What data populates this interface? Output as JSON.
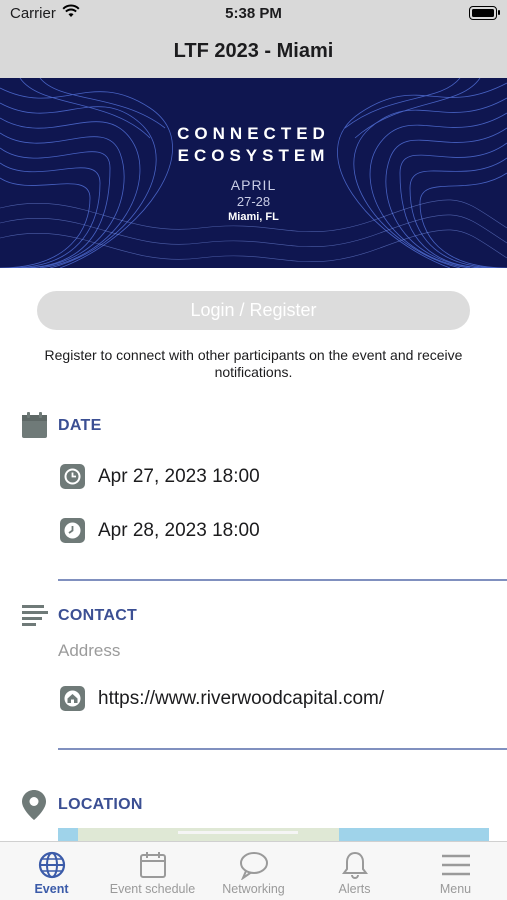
{
  "status_bar": {
    "carrier": "Carrier",
    "time": "5:38 PM"
  },
  "nav": {
    "title": "LTF 2023 - Miami"
  },
  "banner": {
    "line1": "CONNECTED",
    "line2": "ECOSYSTEM",
    "month": "APRIL",
    "days": "27-28",
    "place": "Miami, FL"
  },
  "login": {
    "button_label": "Login / Register",
    "note": "Register to connect with other participants on the event and receive notifications."
  },
  "date_section": {
    "title": "DATE",
    "items": [
      {
        "icon": "clock-icon",
        "text": "Apr 27, 2023 18:00"
      },
      {
        "icon": "clock-icon",
        "text": "Apr 28, 2023 18:00"
      }
    ]
  },
  "contact_section": {
    "title": "CONTACT",
    "address_label": "Address",
    "website": "https://www.riverwoodcapital.com/"
  },
  "location_section": {
    "title": "LOCATION"
  },
  "tabbar": {
    "items": [
      {
        "label": "Event",
        "icon": "globe-icon",
        "active": true
      },
      {
        "label": "Event schedule",
        "icon": "calendar-icon",
        "active": false
      },
      {
        "label": "Networking",
        "icon": "chat-bubble-icon",
        "active": false
      },
      {
        "label": "Alerts",
        "icon": "bell-icon",
        "active": false
      },
      {
        "label": "Menu",
        "icon": "hamburger-icon",
        "active": false
      }
    ]
  },
  "colors": {
    "accent": "#3b4f93",
    "tab_active": "#3b5ba9",
    "banner_bg": "#0f1650",
    "icon_gray": "#6f7a78"
  }
}
